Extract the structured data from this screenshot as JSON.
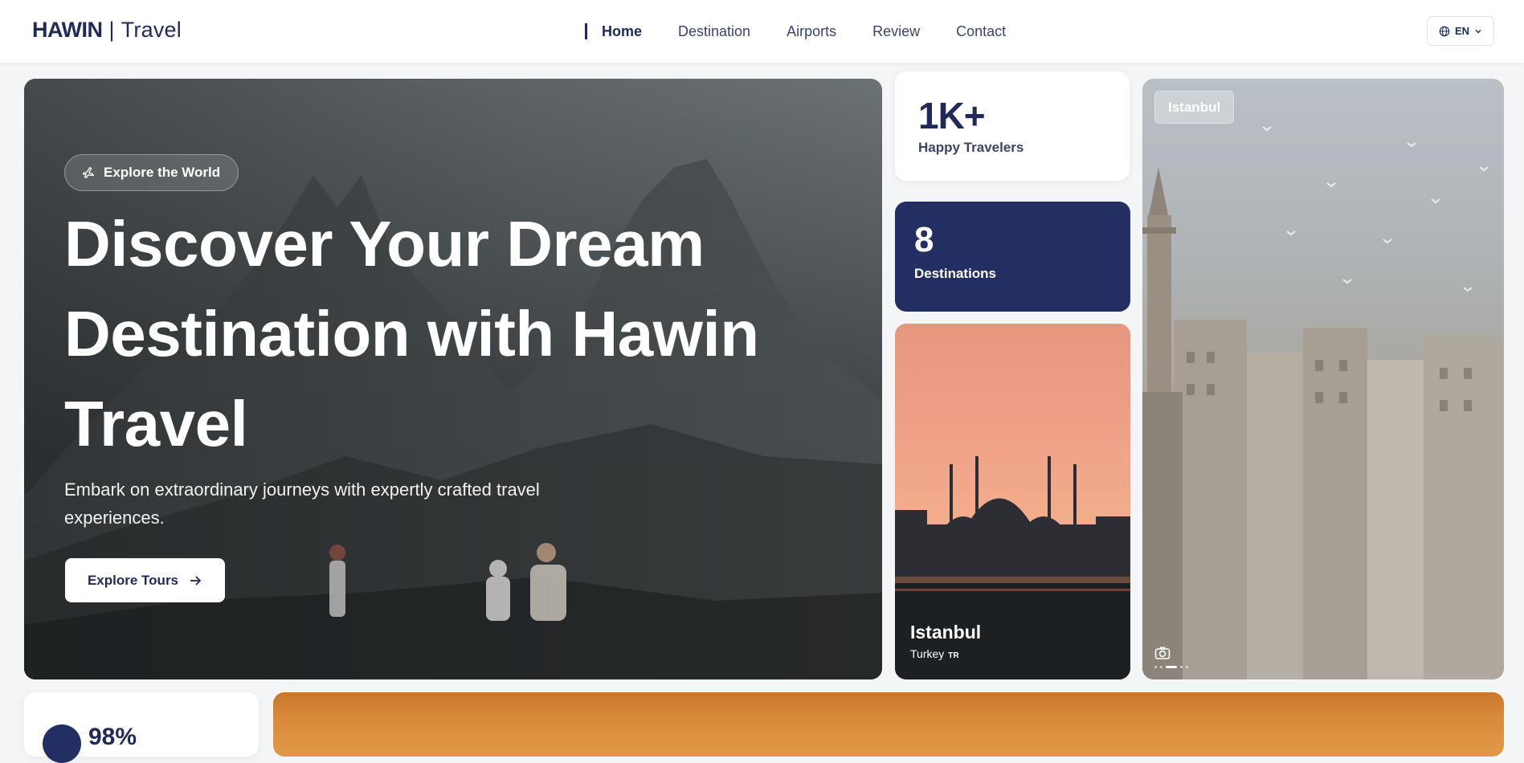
{
  "header": {
    "brand": "HAWIN",
    "separator": "|",
    "brand_sub": "Travel",
    "nav": [
      {
        "label": "Home",
        "active": true
      },
      {
        "label": "Destination",
        "active": false
      },
      {
        "label": "Airports",
        "active": false
      },
      {
        "label": "Review",
        "active": false
      },
      {
        "label": "Contact",
        "active": false
      }
    ],
    "language": "EN",
    "language_icon": "globe-icon"
  },
  "hero": {
    "chip_label": "Explore the World",
    "chip_icon": "plane-icon",
    "title": "Discover Your Dream Destination with Hawin Travel",
    "lead": "Embark on extraordinary journeys with expertly crafted travel experiences.",
    "cta_label": "Explore Tours",
    "cta_icon": "arrow-right-icon"
  },
  "stats": {
    "travelers": {
      "value": "1K+",
      "label": "Happy Travelers"
    },
    "destinations": {
      "value": "8",
      "label": "Destinations"
    }
  },
  "destination_card": {
    "name": "Istanbul",
    "country": "Turkey",
    "country_code": "TR"
  },
  "feature_card": {
    "tag": "Istanbul",
    "camera_icon": "camera-icon",
    "slides_total": 5,
    "slide_active": 3
  },
  "bottom": {
    "percent": "98%"
  },
  "colors": {
    "navy": "#232e63",
    "text": "#1f2a5a",
    "background": "#f4f5f7"
  }
}
